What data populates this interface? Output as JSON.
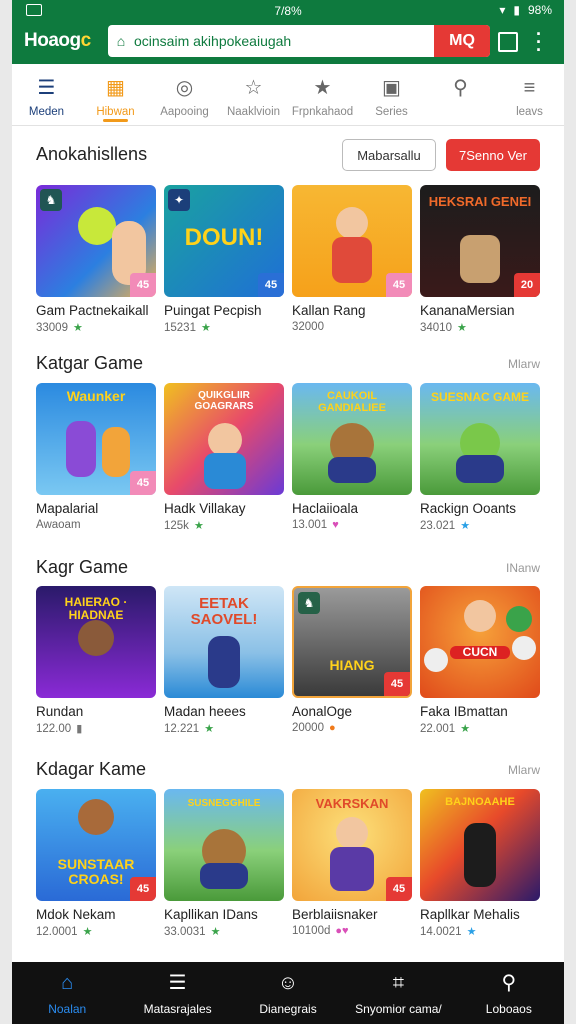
{
  "status": {
    "center": "7/8%",
    "battery": "98%"
  },
  "app": {
    "logo_main": "Hoaog",
    "logo_accent": "c",
    "search_value": "ocinsaim akihpokeaiugah",
    "search_button": "MQ"
  },
  "tabs": [
    {
      "label": "Meden",
      "icon": "menu-icon",
      "state": "active-blue"
    },
    {
      "label": "Hibwan",
      "icon": "grid-icon",
      "state": "active-orange"
    },
    {
      "label": "Aapooing",
      "icon": "compass-icon",
      "state": ""
    },
    {
      "label": "Naaklvioin",
      "icon": "star-outline-icon",
      "state": ""
    },
    {
      "label": "Frpnkahaod",
      "icon": "star-icon",
      "state": ""
    },
    {
      "label": "Series",
      "icon": "card-icon",
      "state": ""
    },
    {
      "label": "",
      "icon": "search-icon",
      "state": ""
    },
    {
      "label": "leavs",
      "icon": "hamburger-icon",
      "state": ""
    }
  ],
  "sections": [
    {
      "title": "Anokahisllens",
      "see_all": "",
      "btn_outline": "Mabarsallu",
      "btn_red": "7Senno Ver",
      "cards": [
        {
          "name": "Gam Pactnekaikall",
          "meta": "33009",
          "meta_icon": "★",
          "meta_color": "#3aa34a",
          "art": "",
          "tl": "♞",
          "br": "45"
        },
        {
          "name": "Puingat Pecpish",
          "meta": "15231",
          "meta_icon": "★",
          "meta_color": "#3aa34a",
          "art": "DOUN!",
          "tl": "✦",
          "br": "45"
        },
        {
          "name": "Kallan Rang",
          "meta": "32000",
          "meta_icon": "",
          "meta_color": "#3aa34a",
          "art": "",
          "tl": "",
          "br": "45"
        },
        {
          "name": "KananaMersian",
          "meta": "34010",
          "meta_icon": "★",
          "meta_color": "#3aa34a",
          "art": "HEKSRAI GENEI",
          "tl": "",
          "br": "20"
        }
      ]
    },
    {
      "title": "Katgar Game",
      "see_all": "Mlarw",
      "btn_outline": "",
      "btn_red": "",
      "cards": [
        {
          "name": "Mapalarial",
          "meta": "Awaoam",
          "meta_icon": "",
          "meta_color": "#3aa34a",
          "art": "Waunker",
          "tl": "",
          "br": "45"
        },
        {
          "name": "Hadk Villakay",
          "meta": "125k",
          "meta_icon": "★",
          "meta_color": "#3aa34a",
          "art": "QUIKGLIIR GOAGRARS",
          "tl": "",
          "br": ""
        },
        {
          "name": "Haclaiioala",
          "meta": "13.001",
          "meta_icon": "♥",
          "meta_color": "#d94fb8",
          "art": "CAUKOIL GANDIALIEE",
          "tl": "",
          "br": ""
        },
        {
          "name": "Rackign Ooants",
          "meta": "23.021",
          "meta_icon": "★",
          "meta_color": "#2aa0e6",
          "art": "SUESNAC GAME",
          "tl": "",
          "br": ""
        }
      ]
    },
    {
      "title": "Kagr Game",
      "see_all": "INanw",
      "btn_outline": "",
      "btn_red": "",
      "cards": [
        {
          "name": "Rundan",
          "meta": "122.00",
          "meta_icon": "▮",
          "meta_color": "#777777",
          "art": "HAIERAO · HIADNAE",
          "tl": "",
          "br": ""
        },
        {
          "name": "Madan heees",
          "meta": "12.221",
          "meta_icon": "★",
          "meta_color": "#3aa34a",
          "art": "EETAK SAOVEL!",
          "tl": "",
          "br": ""
        },
        {
          "name": "AonalOge",
          "meta": "20000",
          "meta_icon": "●",
          "meta_color": "#f07a1a",
          "art": "HIANG",
          "tl": "♞",
          "br": "45"
        },
        {
          "name": "Faka IBmattan",
          "meta": "22.001",
          "meta_icon": "★",
          "meta_color": "#3aa34a",
          "art": "CUCN",
          "tl": "",
          "br": ""
        }
      ]
    },
    {
      "title": "Kdagar Kame",
      "see_all": "Mlarw",
      "btn_outline": "",
      "btn_red": "",
      "cards": [
        {
          "name": "Mdok Nekam",
          "meta": "12.0001",
          "meta_icon": "★",
          "meta_color": "#3aa34a",
          "art": "SUNSTAAR CROAS!",
          "tl": "",
          "br": "45"
        },
        {
          "name": "Kapllikan IDans",
          "meta": "33.0031",
          "meta_icon": "★",
          "meta_color": "#3aa34a",
          "art": "SUSNEGGHILE",
          "tl": "",
          "br": ""
        },
        {
          "name": "Berblaiisnaker",
          "meta": "10100d",
          "meta_icon": "●♥",
          "meta_color": "#d94fb8",
          "art": "VAKRSKAN",
          "tl": "",
          "br": "45"
        },
        {
          "name": "Rapllkar Mehalis",
          "meta": "14.0021",
          "meta_icon": "★",
          "meta_color": "#2aa0e6",
          "art": "BAJNOAAHE",
          "tl": "",
          "br": ""
        }
      ]
    }
  ],
  "bottom_nav": [
    {
      "label": "Noalan",
      "icon": "home-icon",
      "active": true
    },
    {
      "label": "Matasrajales",
      "icon": "list-icon",
      "active": false
    },
    {
      "label": "Dianegrais",
      "icon": "person-icon",
      "active": false
    },
    {
      "label": "Snyomior cama/",
      "icon": "tag-icon",
      "active": false
    },
    {
      "label": "Loboaos",
      "icon": "search-icon",
      "active": false
    }
  ],
  "colors": {
    "brand": "#0e7a3e",
    "accent_red": "#e53935",
    "tab_orange": "#f29a1a",
    "nav_active": "#2a8cf0"
  }
}
